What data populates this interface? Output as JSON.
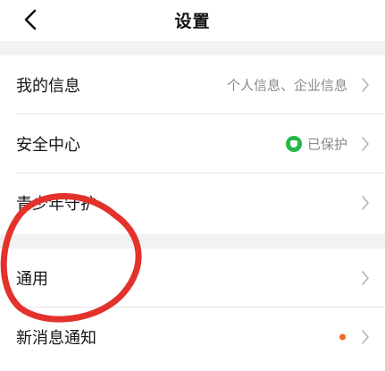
{
  "header": {
    "title": "设置"
  },
  "groups": [
    {
      "items": [
        {
          "label": "我的信息",
          "value": "个人信息、企业信息"
        },
        {
          "label": "安全中心",
          "value": "已保护"
        },
        {
          "label": "青少年守护",
          "value": ""
        }
      ]
    },
    {
      "items": [
        {
          "label": "通用",
          "value": ""
        },
        {
          "label": "新消息通知",
          "value": ""
        }
      ]
    }
  ],
  "icons": {
    "back": "chevron-left-icon",
    "chevron": "chevron-right-icon",
    "secure": "shield-check-icon",
    "notification": "red-dot-badge"
  },
  "colors": {
    "accent_green": "#25b84a",
    "badge_orange": "#f06a1f",
    "annotation_red": "#e3322b"
  }
}
